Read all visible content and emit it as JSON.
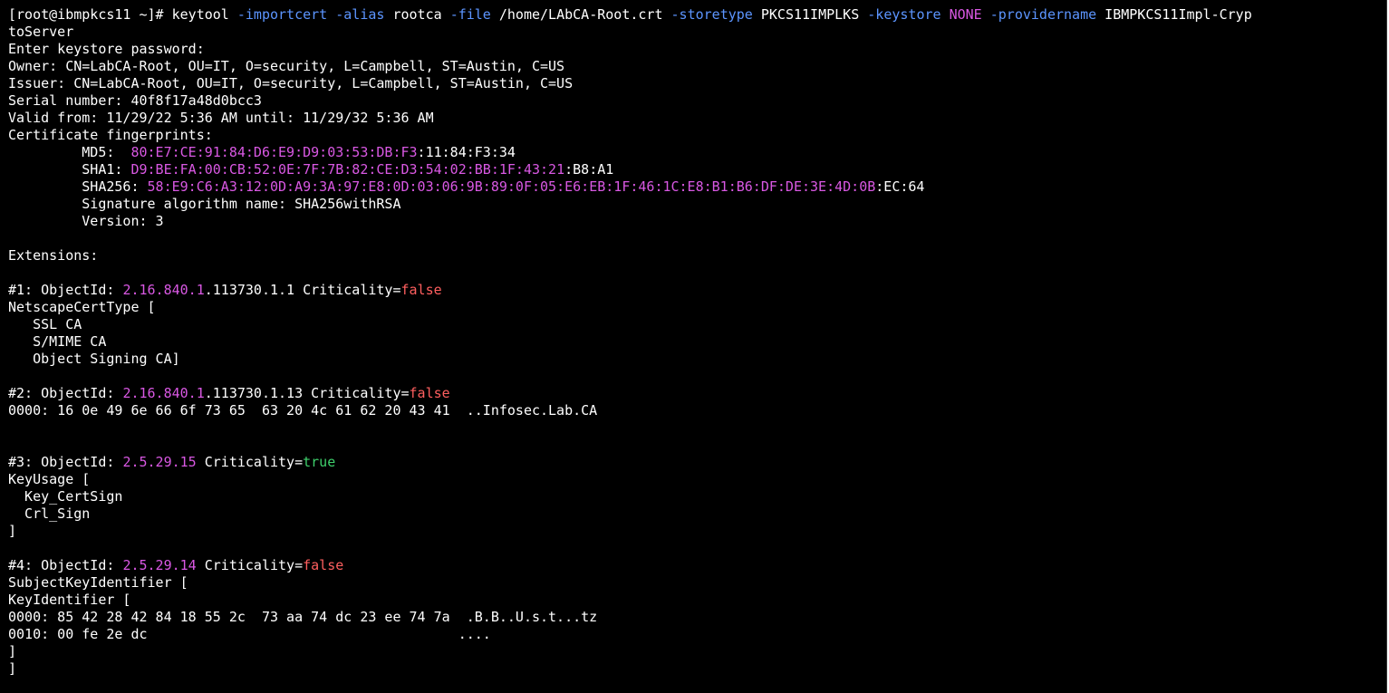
{
  "terminal": {
    "colors": {
      "background": "#000000",
      "default_text": "#ffffff",
      "option_flag": "#5c95ff",
      "magenta_value": "#d958e3",
      "false_value": "#ff5f5f",
      "true_value": "#3ecf6b"
    },
    "lines": [
      {
        "segments": [
          {
            "t": "[root@ibmpkcs11 ~]# keytool ",
            "c": "default"
          },
          {
            "t": "-importcert",
            "c": "option"
          },
          {
            "t": " ",
            "c": "default"
          },
          {
            "t": "-alias",
            "c": "option"
          },
          {
            "t": " rootca ",
            "c": "default"
          },
          {
            "t": "-file",
            "c": "option"
          },
          {
            "t": " /home/LAbCA-Root.crt ",
            "c": "default"
          },
          {
            "t": "-storetype",
            "c": "option"
          },
          {
            "t": " PKCS11IMPLKS ",
            "c": "default"
          },
          {
            "t": "-keystore",
            "c": "option"
          },
          {
            "t": " ",
            "c": "default"
          },
          {
            "t": "NONE",
            "c": "magenta"
          },
          {
            "t": " ",
            "c": "default"
          },
          {
            "t": "-providername",
            "c": "option"
          },
          {
            "t": " IBMPKCS11Impl-Cryp",
            "c": "default"
          }
        ]
      },
      {
        "segments": [
          {
            "t": "toServer",
            "c": "default"
          }
        ]
      },
      {
        "segments": [
          {
            "t": "Enter keystore password:",
            "c": "default"
          }
        ]
      },
      {
        "segments": [
          {
            "t": "Owner: CN=LabCA-Root, OU=IT, O=security, L=Campbell, ST=Austin, C=US",
            "c": "default"
          }
        ]
      },
      {
        "segments": [
          {
            "t": "Issuer: CN=LabCA-Root, OU=IT, O=security, L=Campbell, ST=Austin, C=US",
            "c": "default"
          }
        ]
      },
      {
        "segments": [
          {
            "t": "Serial number: 40f8f17a48d0bcc3",
            "c": "default"
          }
        ]
      },
      {
        "segments": [
          {
            "t": "Valid from: 11/29/22 5:36 AM until: 11/29/32 5:36 AM",
            "c": "default"
          }
        ]
      },
      {
        "segments": [
          {
            "t": "Certificate fingerprints:",
            "c": "default"
          }
        ]
      },
      {
        "segments": [
          {
            "t": "         MD5:  ",
            "c": "default"
          },
          {
            "t": "80:E7:CE:91:84:D6:E9:D9:03:53:DB:F3",
            "c": "magenta"
          },
          {
            "t": ":11:84:F3:34",
            "c": "default"
          }
        ]
      },
      {
        "segments": [
          {
            "t": "         SHA1: ",
            "c": "default"
          },
          {
            "t": "D9:BE:FA:00:CB:52:0E:7F:7B:82:CE:D3:54:02:BB:1F:43:21",
            "c": "magenta"
          },
          {
            "t": ":B8:A1",
            "c": "default"
          }
        ]
      },
      {
        "segments": [
          {
            "t": "         SHA256: ",
            "c": "default"
          },
          {
            "t": "58:E9:C6:A3:12:0D:A9:3A:97:E8:0D:03:06:9B:89:0F:05:E6:EB:1F:46:1C:E8:B1:B6:DF:DE:3E:4D:0B",
            "c": "magenta"
          },
          {
            "t": ":EC:64",
            "c": "default"
          }
        ]
      },
      {
        "segments": [
          {
            "t": "         Signature algorithm name: SHA256withRSA",
            "c": "default"
          }
        ]
      },
      {
        "segments": [
          {
            "t": "         Version: 3",
            "c": "default"
          }
        ]
      },
      {
        "segments": [
          {
            "t": "",
            "c": "default"
          }
        ]
      },
      {
        "segments": [
          {
            "t": "Extensions:",
            "c": "default"
          }
        ]
      },
      {
        "segments": [
          {
            "t": "",
            "c": "default"
          }
        ]
      },
      {
        "segments": [
          {
            "t": "#1: ObjectId: ",
            "c": "default"
          },
          {
            "t": "2.16.840.1",
            "c": "magenta"
          },
          {
            "t": ".113730.1.1 Criticality=",
            "c": "default"
          },
          {
            "t": "false",
            "c": "false"
          }
        ]
      },
      {
        "segments": [
          {
            "t": "NetscapeCertType [",
            "c": "default"
          }
        ]
      },
      {
        "segments": [
          {
            "t": "   SSL CA",
            "c": "default"
          }
        ]
      },
      {
        "segments": [
          {
            "t": "   S/MIME CA",
            "c": "default"
          }
        ]
      },
      {
        "segments": [
          {
            "t": "   Object Signing CA]",
            "c": "default"
          }
        ]
      },
      {
        "segments": [
          {
            "t": "",
            "c": "default"
          }
        ]
      },
      {
        "segments": [
          {
            "t": "#2: ObjectId: ",
            "c": "default"
          },
          {
            "t": "2.16.840.1",
            "c": "magenta"
          },
          {
            "t": ".113730.1.13 Criticality=",
            "c": "default"
          },
          {
            "t": "false",
            "c": "false"
          }
        ]
      },
      {
        "segments": [
          {
            "t": "0000: 16 0e 49 6e 66 6f 73 65  63 20 4c 61 62 20 43 41  ..Infosec.Lab.CA",
            "c": "default"
          }
        ]
      },
      {
        "segments": [
          {
            "t": "",
            "c": "default"
          }
        ]
      },
      {
        "segments": [
          {
            "t": "",
            "c": "default"
          }
        ]
      },
      {
        "segments": [
          {
            "t": "#3: ObjectId: ",
            "c": "default"
          },
          {
            "t": "2.5.29.15",
            "c": "magenta"
          },
          {
            "t": " Criticality=",
            "c": "default"
          },
          {
            "t": "true",
            "c": "true"
          }
        ]
      },
      {
        "segments": [
          {
            "t": "KeyUsage [",
            "c": "default"
          }
        ]
      },
      {
        "segments": [
          {
            "t": "  Key_CertSign",
            "c": "default"
          }
        ]
      },
      {
        "segments": [
          {
            "t": "  Crl_Sign",
            "c": "default"
          }
        ]
      },
      {
        "segments": [
          {
            "t": "]",
            "c": "default"
          }
        ]
      },
      {
        "segments": [
          {
            "t": "",
            "c": "default"
          }
        ]
      },
      {
        "segments": [
          {
            "t": "#4: ObjectId: ",
            "c": "default"
          },
          {
            "t": "2.5.29.14",
            "c": "magenta"
          },
          {
            "t": " Criticality=",
            "c": "default"
          },
          {
            "t": "false",
            "c": "false"
          }
        ]
      },
      {
        "segments": [
          {
            "t": "SubjectKeyIdentifier [",
            "c": "default"
          }
        ]
      },
      {
        "segments": [
          {
            "t": "KeyIdentifier [",
            "c": "default"
          }
        ]
      },
      {
        "segments": [
          {
            "t": "0000: 85 42 28 42 84 18 55 2c  73 aa 74 dc 23 ee 74 7a  .B.B..U.s.t...tz",
            "c": "default"
          }
        ]
      },
      {
        "segments": [
          {
            "t": "0010: 00 fe 2e dc                                      ....",
            "c": "default"
          }
        ]
      },
      {
        "segments": [
          {
            "t": "]",
            "c": "default"
          }
        ]
      },
      {
        "segments": [
          {
            "t": "]",
            "c": "default"
          }
        ]
      }
    ]
  }
}
